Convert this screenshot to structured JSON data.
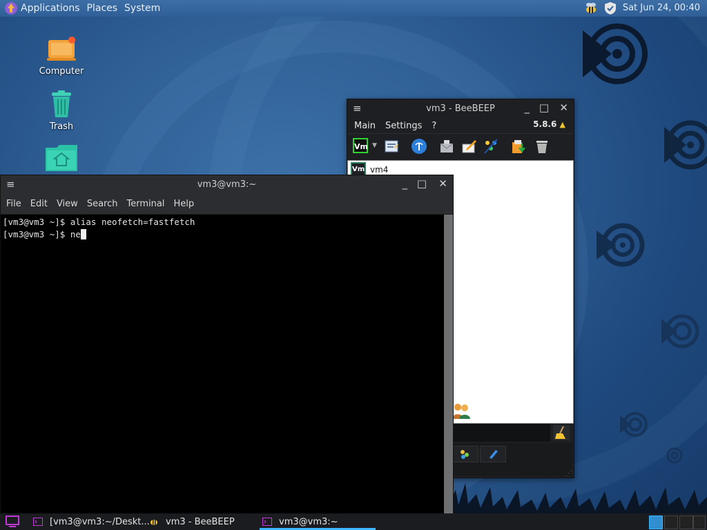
{
  "top_panel": {
    "menus": [
      "Applications",
      "Places",
      "System"
    ],
    "clock": "Sat Jun 24, 00:40"
  },
  "desktop_icons": [
    {
      "label": "Computer"
    },
    {
      "label": "Trash"
    },
    {
      "label": ""
    }
  ],
  "beebeep": {
    "title": "vm3 - BeeBEEP",
    "menus": [
      "Main",
      "Settings",
      "?"
    ],
    "version": "5.8.6",
    "status_badge": "Vm",
    "users": [
      {
        "name": "vm4",
        "avatar": "Vm"
      }
    ]
  },
  "terminal": {
    "title": "vm3@vm3:~",
    "menus": [
      "File",
      "Edit",
      "View",
      "Search",
      "Terminal",
      "Help"
    ],
    "lines": [
      "[vm3@vm3 ~]$ alias neofetch=fastfetch",
      "[vm3@vm3 ~]$ ne"
    ]
  },
  "taskbar": {
    "tasks": [
      {
        "label": "[vm3@vm3:~/Deskt...",
        "icon": "terminal-icon"
      },
      {
        "label": "vm3 - BeeBEEP",
        "icon": "bee-icon"
      },
      {
        "label": "vm3@vm3:~",
        "icon": "terminal-icon",
        "active": true
      }
    ]
  },
  "colors": {
    "accent": "#3db7ff",
    "terminal_bg": "#000000",
    "panel_bg": "#2f5f96"
  }
}
